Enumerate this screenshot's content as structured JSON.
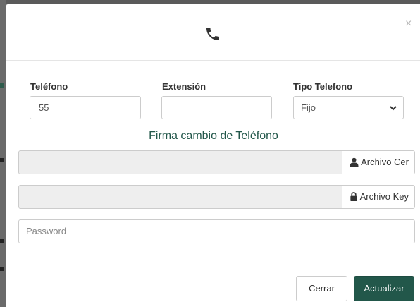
{
  "modal": {
    "header_icon": "phone-icon",
    "close_label": "×"
  },
  "form": {
    "telefono": {
      "label": "Teléfono",
      "value": "55"
    },
    "extension": {
      "label": "Extensión",
      "value": ""
    },
    "tipo_telefono": {
      "label": "Tipo Telefono",
      "selected": "Fijo"
    }
  },
  "firma": {
    "title": "Firma cambio de Teléfono",
    "archivo_cer": {
      "label": "Archivo Cer",
      "icon": "user-icon"
    },
    "archivo_key": {
      "label": "Archivo Key",
      "icon": "lock-icon"
    },
    "password_placeholder": "Password"
  },
  "footer": {
    "cerrar": "Cerrar",
    "actualizar": "Actualizar"
  },
  "colors": {
    "primary": "#22574a",
    "title_text": "#22574a"
  }
}
